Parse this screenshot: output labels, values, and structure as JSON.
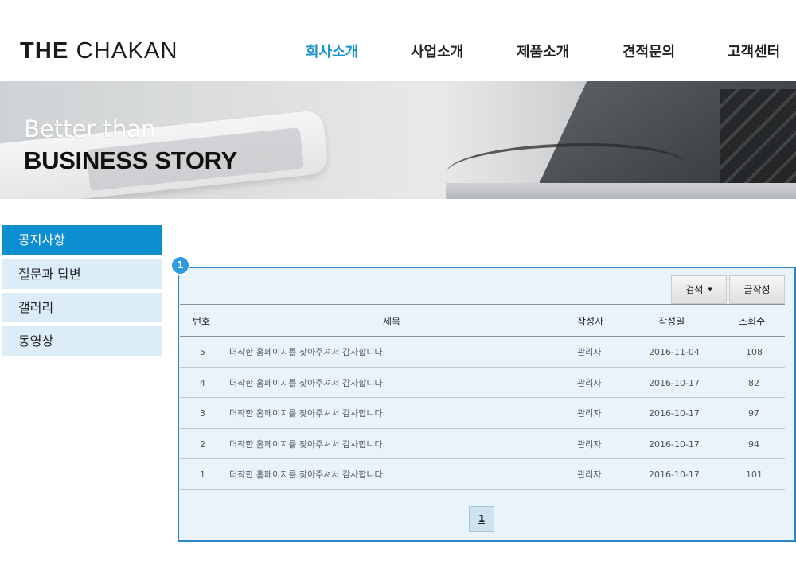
{
  "header": {
    "logo_bold": "THE",
    "logo_light": "CHAKAN",
    "nav": [
      "회사소개",
      "사업소개",
      "제품소개",
      "견적문의",
      "고객센터"
    ],
    "active_nav": "회사소개",
    "accent_color": "#1a8fd4"
  },
  "hero": {
    "subtitle": "Better than",
    "title": "BUSINESS STORY"
  },
  "sidebar": {
    "items": [
      "공지사항",
      "질문과 답변",
      "갤러리",
      "동영상"
    ],
    "active": "공지사항",
    "active_color": "#0b8fd0"
  },
  "board": {
    "badge": "1",
    "search_label": "검색",
    "search_caret": "▼",
    "write_label": "글작성",
    "columns": {
      "no": "번호",
      "title": "제목",
      "author": "작성자",
      "date": "작성일",
      "views": "조회수"
    },
    "rows": [
      {
        "no": "5",
        "title": "더착한 홈페이지를 찾아주셔서 감사합니다.",
        "author": "관리자",
        "date": "2016-11-04",
        "views": "108"
      },
      {
        "no": "4",
        "title": "더착한 홈페이지를 찾아주셔서 감사합니다.",
        "author": "관리자",
        "date": "2016-10-17",
        "views": "82"
      },
      {
        "no": "3",
        "title": "더착한 홈페이지를 찾아주셔서 감사합니다.",
        "author": "관리자",
        "date": "2016-10-17",
        "views": "97"
      },
      {
        "no": "2",
        "title": "더착한 홈페이지를 찾아주셔서 감사합니다.",
        "author": "관리자",
        "date": "2016-10-17",
        "views": "94"
      },
      {
        "no": "1",
        "title": "더착한 홈페이지를 찾아주셔서 감사합니다.",
        "author": "관리자",
        "date": "2016-10-17",
        "views": "101"
      }
    ],
    "page": "1"
  }
}
